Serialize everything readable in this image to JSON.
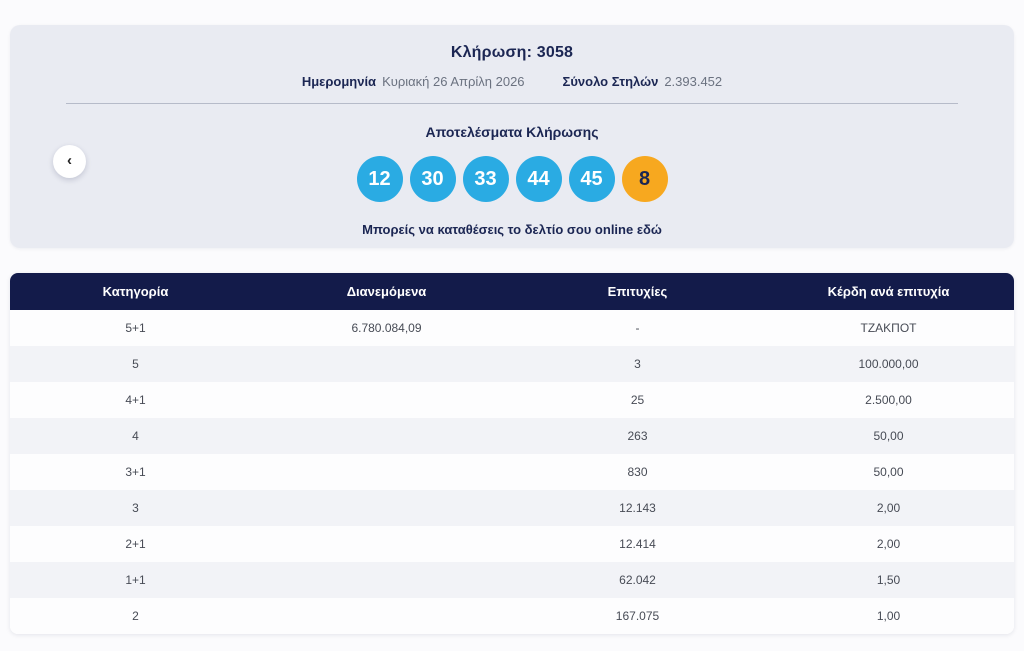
{
  "draw": {
    "title": "Κλήρωση: 3058",
    "date_label": "Ημερομηνία",
    "date_value": "Κυριακή 26 Απρίλη 2026",
    "columns_label": "Σύνολο Στηλών",
    "columns_value": "2.393.452",
    "results_title": "Αποτελέσματα Κλήρωσης",
    "numbers": [
      "12",
      "30",
      "33",
      "44",
      "45"
    ],
    "joker_number": "8",
    "deposit_text": "Μπορείς να καταθέσεις το δελτίο σου online",
    "deposit_link_text": "εδώ"
  },
  "icons": {
    "prev_chevron": "‹"
  },
  "colors": {
    "ball_blue": "#2aabe3",
    "ball_orange": "#f7a81f",
    "navy_text": "#1b2653",
    "table_header_bg": "#131b4a",
    "card_bg": "#e9ebf2"
  },
  "table": {
    "headers": [
      "Κατηγορία",
      "Διανεμόμενα",
      "Επιτυχίες",
      "Κέρδη ανά επιτυχία"
    ],
    "rows": [
      {
        "category": "5+1",
        "distributed": "6.780.084,09",
        "winners": "-",
        "prize": "ΤΖΑΚΠΟΤ"
      },
      {
        "category": "5",
        "distributed": "",
        "winners": "3",
        "prize": "100.000,00"
      },
      {
        "category": "4+1",
        "distributed": "",
        "winners": "25",
        "prize": "2.500,00"
      },
      {
        "category": "4",
        "distributed": "",
        "winners": "263",
        "prize": "50,00"
      },
      {
        "category": "3+1",
        "distributed": "",
        "winners": "830",
        "prize": "50,00"
      },
      {
        "category": "3",
        "distributed": "",
        "winners": "12.143",
        "prize": "2,00"
      },
      {
        "category": "2+1",
        "distributed": "",
        "winners": "12.414",
        "prize": "2,00"
      },
      {
        "category": "1+1",
        "distributed": "",
        "winners": "62.042",
        "prize": "1,50"
      },
      {
        "category": "2",
        "distributed": "",
        "winners": "167.075",
        "prize": "1,00"
      }
    ]
  }
}
